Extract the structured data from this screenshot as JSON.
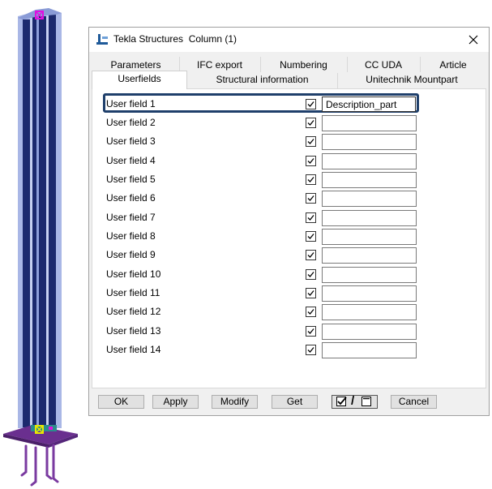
{
  "window": {
    "app": "Tekla Structures",
    "title": "Tekla Structures  Column (1)"
  },
  "tabs_row1": [
    "Parameters",
    "IFC export",
    "Numbering",
    "CC UDA",
    "Article"
  ],
  "tabs_row2": [
    "Userfields",
    "Structural information",
    "Unitechnik Mountpart"
  ],
  "active_tab": "Userfields",
  "userfields": [
    {
      "label": "User field 1",
      "checked": true,
      "value": "Description_part"
    },
    {
      "label": "User field 2",
      "checked": true,
      "value": ""
    },
    {
      "label": "User field 3",
      "checked": true,
      "value": ""
    },
    {
      "label": "User field 4",
      "checked": true,
      "value": ""
    },
    {
      "label": "User field 5",
      "checked": true,
      "value": ""
    },
    {
      "label": "User field 6",
      "checked": true,
      "value": ""
    },
    {
      "label": "User field 7",
      "checked": true,
      "value": ""
    },
    {
      "label": "User field 8",
      "checked": true,
      "value": ""
    },
    {
      "label": "User field 9",
      "checked": true,
      "value": ""
    },
    {
      "label": "User field 10",
      "checked": true,
      "value": ""
    },
    {
      "label": "User field 11",
      "checked": true,
      "value": ""
    },
    {
      "label": "User field 12",
      "checked": true,
      "value": ""
    },
    {
      "label": "User field 13",
      "checked": true,
      "value": ""
    },
    {
      "label": "User field 14",
      "checked": true,
      "value": ""
    }
  ],
  "buttons": {
    "ok": "OK",
    "apply": "Apply",
    "modify": "Modify",
    "get": "Get",
    "toggle_sep": "/",
    "cancel": "Cancel"
  },
  "icons": {
    "title": "tekla-column-icon",
    "close": "close-icon",
    "check": "checkmark-icon"
  },
  "colors": {
    "highlight": "#1f3f6b",
    "column_dark": "#1c2a6e",
    "column_light": "#a9b7e6",
    "base_plate": "#6a2f8f",
    "anchor_bolts": "#7a3aa0",
    "node_magenta": "#e010e0",
    "node_yellow": "#e8e800"
  }
}
